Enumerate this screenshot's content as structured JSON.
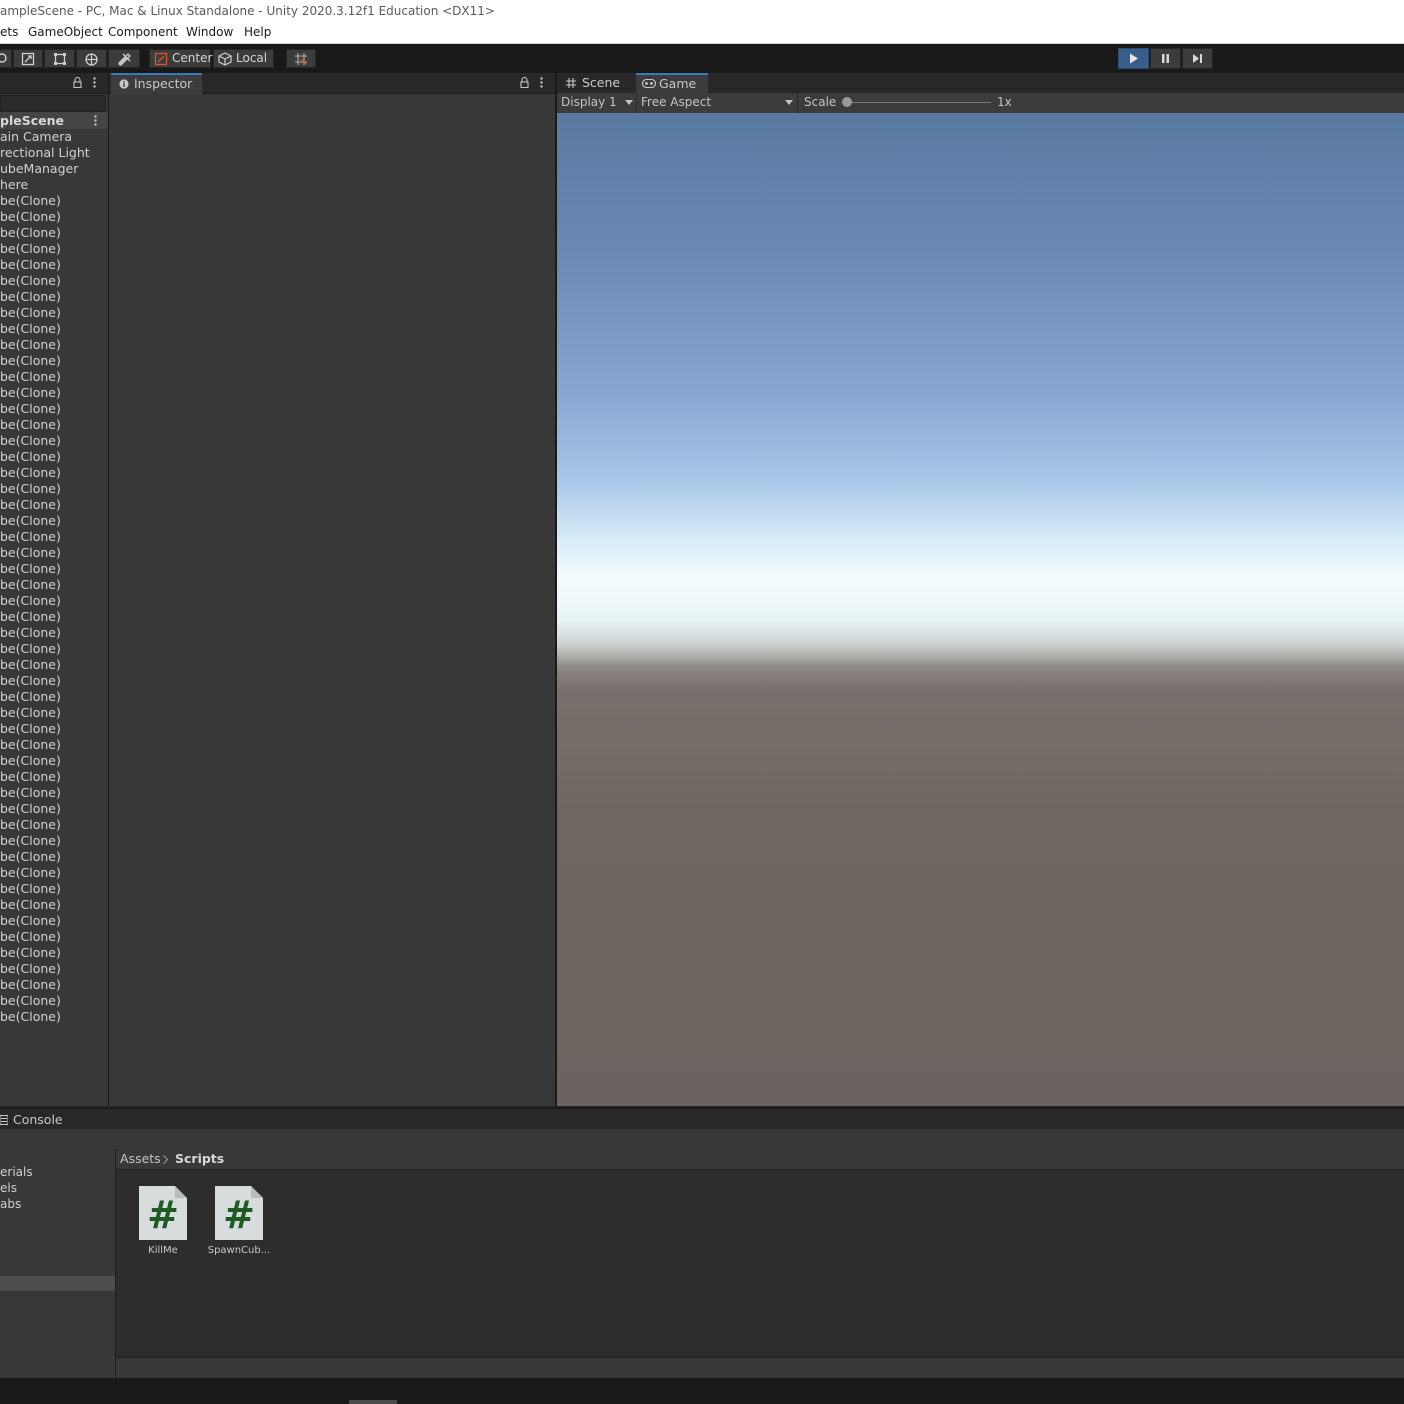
{
  "window": {
    "title": "ampleScene - PC, Mac & Linux Standalone - Unity 2020.3.12f1 Education <DX11>"
  },
  "menubar": {
    "items": [
      "ets",
      "GameObject",
      "Component",
      "Window",
      "Help"
    ]
  },
  "toolbar": {
    "pivot_label": "Center",
    "space_label": "Local"
  },
  "hierarchy": {
    "scene": "pleScene",
    "items": [
      "ain Camera",
      "rectional Light",
      "ubeManager",
      "here",
      "be(Clone)",
      "be(Clone)",
      "be(Clone)",
      "be(Clone)",
      "be(Clone)",
      "be(Clone)",
      "be(Clone)",
      "be(Clone)",
      "be(Clone)",
      "be(Clone)",
      "be(Clone)",
      "be(Clone)",
      "be(Clone)",
      "be(Clone)",
      "be(Clone)",
      "be(Clone)",
      "be(Clone)",
      "be(Clone)",
      "be(Clone)",
      "be(Clone)",
      "be(Clone)",
      "be(Clone)",
      "be(Clone)",
      "be(Clone)",
      "be(Clone)",
      "be(Clone)",
      "be(Clone)",
      "be(Clone)",
      "be(Clone)",
      "be(Clone)",
      "be(Clone)",
      "be(Clone)",
      "be(Clone)",
      "be(Clone)",
      "be(Clone)",
      "be(Clone)",
      "be(Clone)",
      "be(Clone)",
      "be(Clone)",
      "be(Clone)",
      "be(Clone)",
      "be(Clone)",
      "be(Clone)",
      "be(Clone)",
      "be(Clone)",
      "be(Clone)",
      "be(Clone)",
      "be(Clone)",
      "be(Clone)",
      "be(Clone)",
      "be(Clone)",
      "be(Clone)"
    ]
  },
  "inspector": {
    "tab_label": "Inspector"
  },
  "game": {
    "scene_tab": "Scene",
    "game_tab": "Game",
    "display": "Display 1",
    "aspect": "Free Aspect",
    "scale_label": "Scale",
    "scale_value": "1x",
    "scale_slider_fraction": 0
  },
  "console": {
    "tab_label": "Console"
  },
  "project": {
    "breadcrumb_root": "Assets",
    "breadcrumb_current": "Scripts",
    "folders": [
      "erials",
      "els",
      "abs"
    ],
    "assets": [
      {
        "name": "KillMe",
        "glyph": "#"
      },
      {
        "name": "SpawnCub...",
        "glyph": "#"
      }
    ]
  },
  "colors": {
    "accent": "#3a79bb",
    "play_active": "#3a5e8c",
    "script_icon_hash": "#1e5a25"
  },
  "icons": [
    "lock-icon",
    "kebab-menu-icon",
    "info-icon",
    "grid-icon",
    "gamepad-icon",
    "play-icon",
    "pause-icon",
    "step-icon",
    "console-icon",
    "chevron-right-icon",
    "csharp-script-icon"
  ]
}
